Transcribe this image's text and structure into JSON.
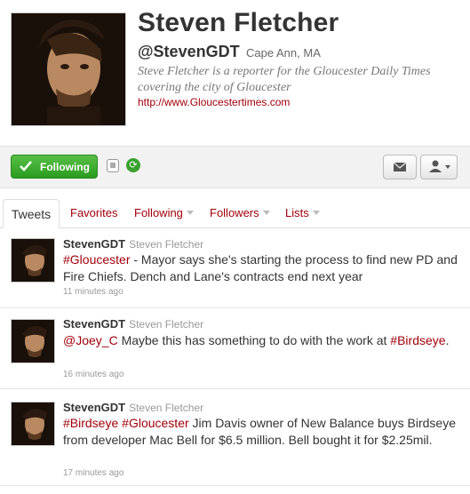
{
  "profile": {
    "name": "Steven Fletcher",
    "handle": "@StevenGDT",
    "location": "Cape Ann, MA",
    "bio": "Steve Fletcher is a reporter for the Gloucester Daily Times covering the city of Gloucester",
    "url": "http://www.Gloucestertimes.com"
  },
  "actions": {
    "follow_label": "Following"
  },
  "tabs": [
    {
      "label": "Tweets"
    },
    {
      "label": "Favorites"
    },
    {
      "label": "Following"
    },
    {
      "label": "Followers"
    },
    {
      "label": "Lists"
    }
  ],
  "tweets": [
    {
      "username": "StevenGDT",
      "fullname": "Steven Fletcher",
      "tag1": "#Gloucester",
      "text": " - Mayor says she's starting the process to find new PD and Fire Chiefs. Dench and Lane's contracts end next year",
      "time": "11 minutes ago"
    },
    {
      "username": "StevenGDT",
      "fullname": "Steven Fletcher",
      "mention": "@Joey_C",
      "text_a": " Maybe this has something to do with the work at ",
      "tag1": "#Birdseye",
      "text_b": ".",
      "time": "16 minutes ago"
    },
    {
      "username": "StevenGDT",
      "fullname": "Steven Fletcher",
      "tag1": "#Birdseye",
      "tag2": "#Gloucester",
      "text": " Jim Davis owner of New Balance buys Birdseye from developer Mac Bell for $6.5 million. Bell bought it for $2.25mil.",
      "time": "17 minutes ago"
    }
  ]
}
